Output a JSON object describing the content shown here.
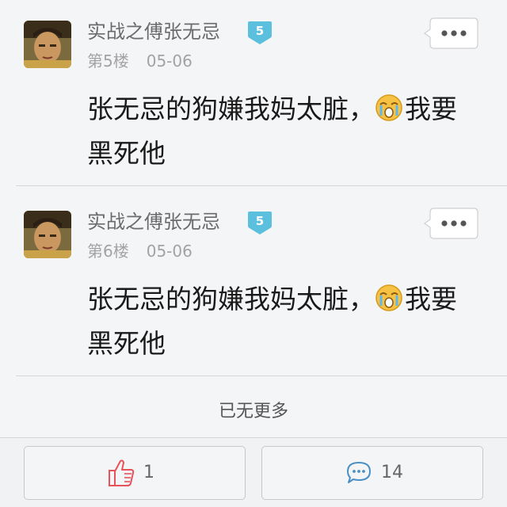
{
  "posts": [
    {
      "username": "实战之傅张无忌",
      "level": "5",
      "floor": "第5楼",
      "date": "05-06",
      "text_before": "张无忌的狗嫌我妈太脏，",
      "emoji": "crying-face-icon",
      "text_after": "我要黑死他"
    },
    {
      "username": "实战之傅张无忌",
      "level": "5",
      "floor": "第6楼",
      "date": "05-06",
      "text_before": "张无忌的狗嫌我妈太脏，",
      "emoji": "crying-face-icon",
      "text_after": "我要黑死他"
    }
  ],
  "footer": {
    "no_more": "已无更多"
  },
  "actions": {
    "like_count": "1",
    "comment_count": "14"
  },
  "colors": {
    "accent_badge": "#5bc0de",
    "like_icon": "#e8525a",
    "comment_icon": "#4a8fc4"
  }
}
